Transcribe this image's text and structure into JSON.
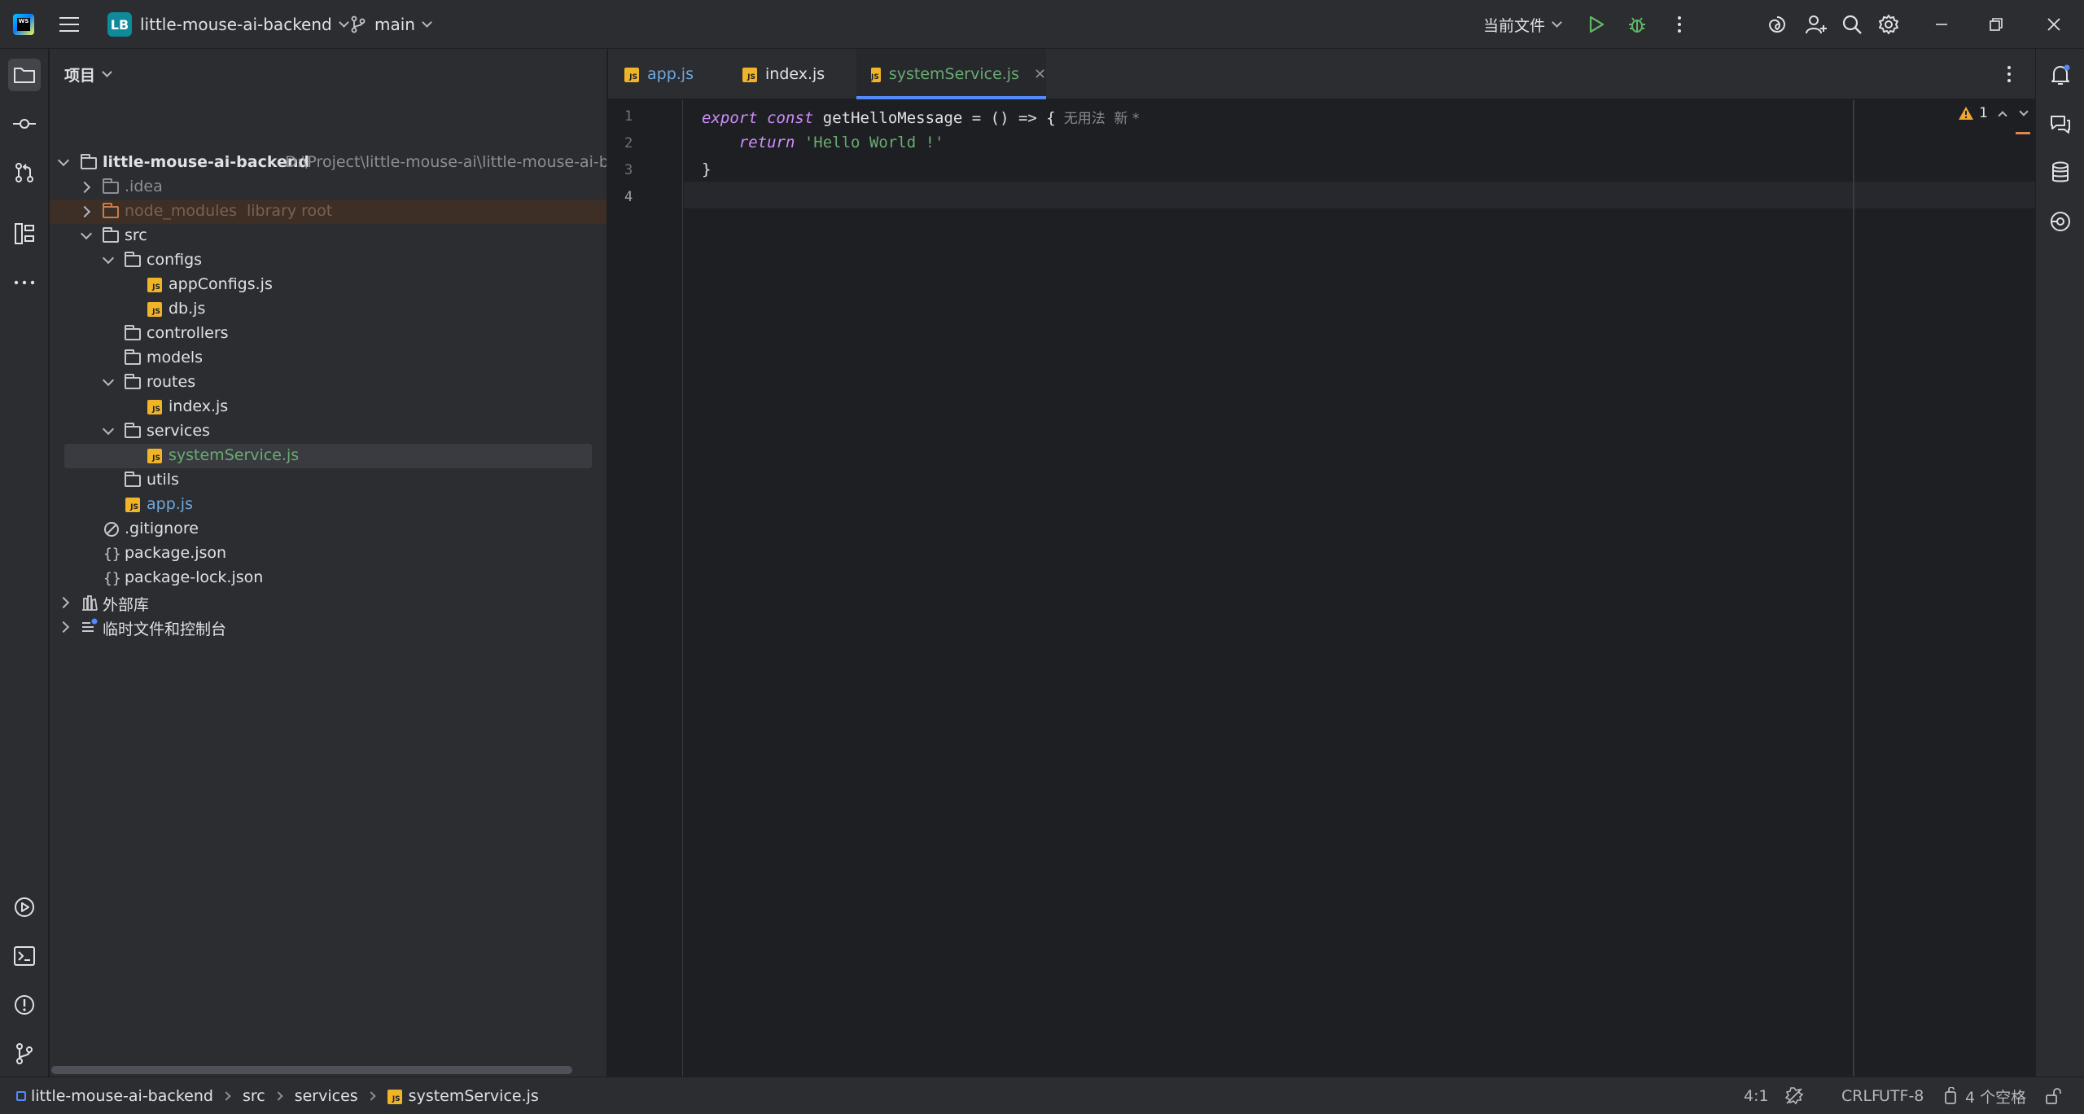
{
  "titlebar": {
    "project_badge": "LB",
    "project_name": "little-mouse-ai-backend",
    "branch": "main",
    "run_config": "当前文件"
  },
  "project_panel": {
    "title": "项目",
    "tree": [
      {
        "label": "little-mouse-ai-backend",
        "extra": "D:\\Project\\little-mouse-ai\\little-mouse-ai-backend",
        "type": "root"
      },
      {
        "label": ".idea",
        "type": "folder"
      },
      {
        "label": "node_modules",
        "extra": "library root",
        "type": "folder-excluded"
      },
      {
        "label": "src",
        "type": "folder"
      },
      {
        "label": "configs",
        "type": "folder"
      },
      {
        "label": "appConfigs.js",
        "type": "js"
      },
      {
        "label": "db.js",
        "type": "js"
      },
      {
        "label": "controllers",
        "type": "folder"
      },
      {
        "label": "models",
        "type": "folder"
      },
      {
        "label": "routes",
        "type": "folder"
      },
      {
        "label": "index.js",
        "type": "js"
      },
      {
        "label": "services",
        "type": "folder"
      },
      {
        "label": "systemService.js",
        "type": "js"
      },
      {
        "label": "utils",
        "type": "folder"
      },
      {
        "label": "app.js",
        "type": "js"
      },
      {
        "label": ".gitignore",
        "type": "ignore"
      },
      {
        "label": "package.json",
        "type": "json"
      },
      {
        "label": "package-lock.json",
        "type": "json"
      },
      {
        "label": "外部库",
        "type": "lib"
      },
      {
        "label": "临时文件和控制台",
        "type": "scratch"
      }
    ]
  },
  "tabs": [
    {
      "label": "app.js"
    },
    {
      "label": "index.js"
    },
    {
      "label": "systemService.js",
      "active": true
    }
  ],
  "editor": {
    "line_numbers": [
      "1",
      "2",
      "3",
      "4"
    ],
    "code": {
      "l1_kw1": "export",
      "l1_kw2": "const",
      "l1_rest": "getHelloMessage = () => {",
      "l1_hint": "无用法  新 *",
      "l2_kw": "return",
      "l2_str": "'Hello World !'",
      "l3": "}"
    },
    "warnings_count": "1"
  },
  "statusbar": {
    "breadcrumb": [
      "little-mouse-ai-backend",
      "src",
      "services",
      "systemService.js"
    ],
    "position": "4:1",
    "line_sep": "CRLF",
    "encoding": "UTF-8",
    "indent": "4 个空格"
  },
  "colors": {
    "accent": "#548af7",
    "selected_file": "#6aab73",
    "modified_tab": "#6aab73",
    "excluded_folder": "#c77d4a",
    "string": "#6aab73",
    "keyword": "#cf8dfb",
    "warning": "#f0a732"
  }
}
